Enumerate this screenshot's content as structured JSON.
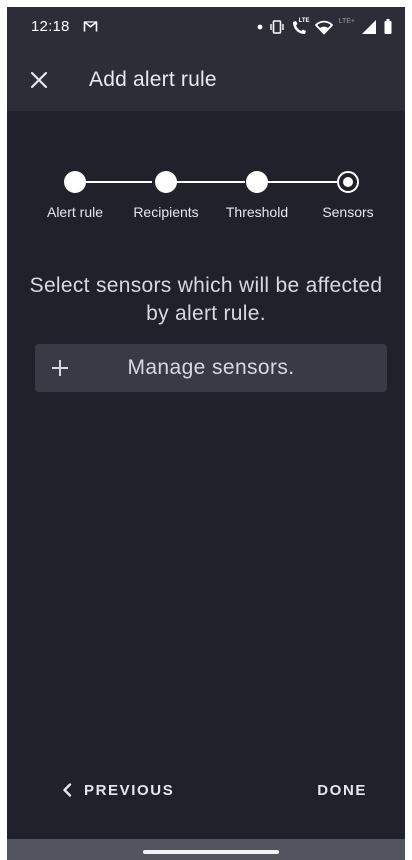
{
  "status_bar": {
    "time": "12:18",
    "icons": [
      "gmail-icon",
      "notification-dot-icon",
      "vibrate-icon",
      "lte-call-icon",
      "wifi-icon",
      "lte-plus-icon",
      "signal-icon",
      "battery-icon"
    ],
    "lte_call_text": "LTE",
    "lte_plus_text": "LTE+"
  },
  "app_bar": {
    "close_icon": "close-icon",
    "title": "Add alert rule"
  },
  "stepper": {
    "steps": [
      {
        "label": "Alert rule",
        "state": "done"
      },
      {
        "label": "Recipients",
        "state": "done"
      },
      {
        "label": "Threshold",
        "state": "done"
      },
      {
        "label": "Sensors",
        "state": "current"
      }
    ]
  },
  "content": {
    "prompt": "Select sensors which will be affected by alert rule.",
    "manage_button": {
      "icon": "plus-icon",
      "label": "Manage sensors."
    }
  },
  "footer": {
    "previous_icon": "chevron-left-icon",
    "previous_label": "PREVIOUS",
    "done_label": "DONE"
  },
  "colors": {
    "background": "#21212b",
    "app_bar": "#2c2d37",
    "button": "#393a45",
    "text": "#e6e6ee",
    "nav_bar": "#525560"
  }
}
